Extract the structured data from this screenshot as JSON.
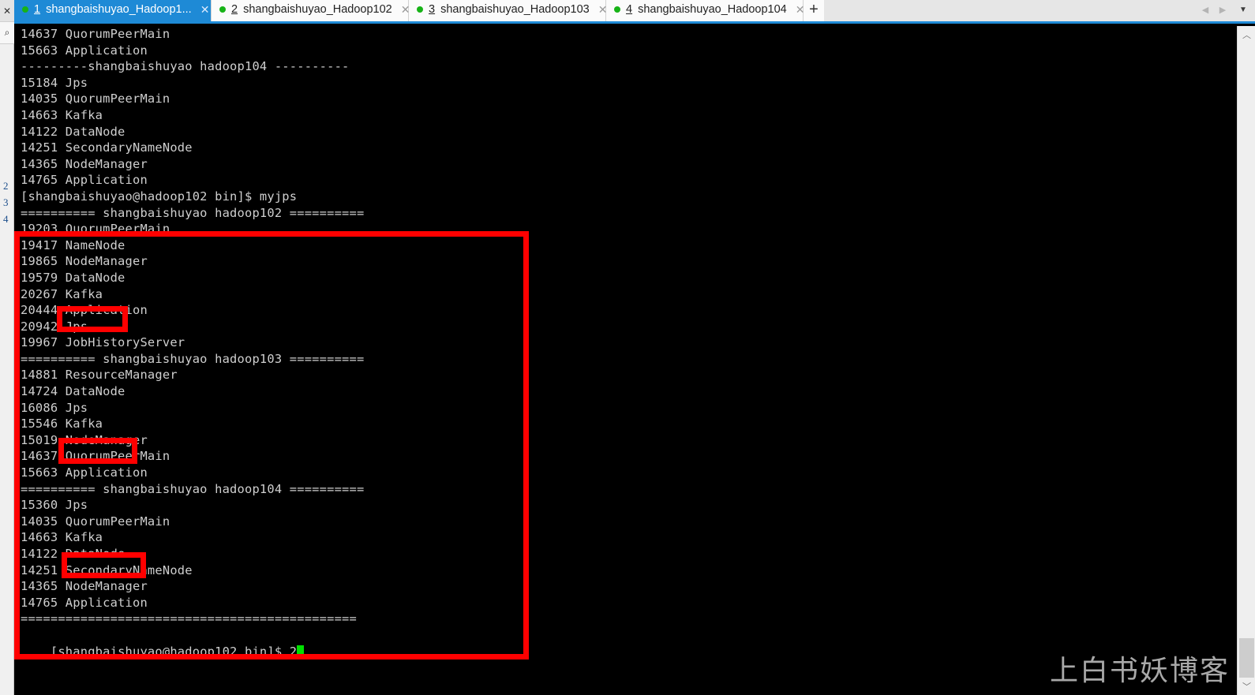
{
  "left_rail": {
    "close_icon": "✕",
    "search_icon": "⌕",
    "tabs": [
      "2",
      "3",
      "4"
    ]
  },
  "tabbar": {
    "tabs": [
      {
        "num": "1",
        "label": "shangbaishuyao_Hadoop1...",
        "active": true,
        "close": "✕"
      },
      {
        "num": "2",
        "label": "shangbaishuyao_Hadoop102",
        "active": false,
        "close": "✕"
      },
      {
        "num": "3",
        "label": "shangbaishuyao_Hadoop103",
        "active": false,
        "close": "✕"
      },
      {
        "num": "4",
        "label": "shangbaishuyao_Hadoop104",
        "active": false,
        "close": "✕"
      }
    ],
    "add_label": "+",
    "nav_prev": "◀",
    "nav_next": "▶",
    "menu": "▼"
  },
  "terminal": {
    "lines": [
      "14637 QuorumPeerMain",
      "15663 Application",
      "---------shangbaishuyao hadoop104 ----------",
      "15184 Jps",
      "14035 QuorumPeerMain",
      "14663 Kafka",
      "14122 DataNode",
      "14251 SecondaryNameNode",
      "14365 NodeManager",
      "14765 Application",
      "[shangbaishuyao@hadoop102 bin]$ myjps",
      "========== shangbaishuyao hadoop102 ==========",
      "19203 QuorumPeerMain",
      "19417 NameNode",
      "19865 NodeManager",
      "19579 DataNode",
      "20267 Kafka",
      "20444 Application",
      "20942 Jps",
      "19967 JobHistoryServer",
      "========== shangbaishuyao hadoop103 ==========",
      "14881 ResourceManager",
      "14724 DataNode",
      "16086 Jps",
      "15546 Kafka",
      "15019 NodeManager",
      "14637 QuorumPeerMain",
      "15663 Application",
      "========== shangbaishuyao hadoop104 ==========",
      "15360 Jps",
      "14035 QuorumPeerMain",
      "14663 Kafka",
      "14122 DataNode",
      "14251 SecondaryNameNode",
      "14365 NodeManager",
      "14765 Application",
      "============================================="
    ],
    "prompt_line": "[shangbaishuyao@hadoop102 bin]$ 2"
  },
  "annotations": {
    "highlight_color": "#ff0000",
    "big_box_label": "myjps-output-box",
    "kafka_boxes": [
      "20267 Kafka",
      "15546 Kafka",
      "14663 Kafka"
    ]
  },
  "watermark": {
    "text": "上白书妖博客"
  },
  "scrollbar": {
    "up": "︿",
    "down": "﹀"
  }
}
